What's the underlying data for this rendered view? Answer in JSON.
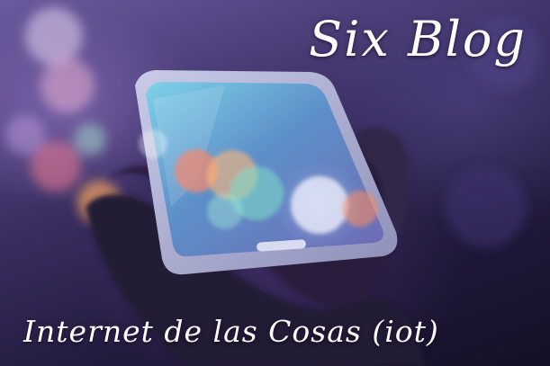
{
  "banner": {
    "title": "Six Blog",
    "subtitle": "Internet de las Cosas (iot)"
  },
  "photo": {
    "subject": "hand-holding-smartphone-with-bokeh-lights",
    "icons": [
      "smartphone-icon",
      "hand-icon"
    ],
    "colors": {
      "background": "#3b2f63",
      "bokeh_orange": "#f2a36b",
      "bokeh_teal": "#6fd6c8",
      "bokeh_pink": "#e8a3c9",
      "text": "#ffffff"
    }
  }
}
